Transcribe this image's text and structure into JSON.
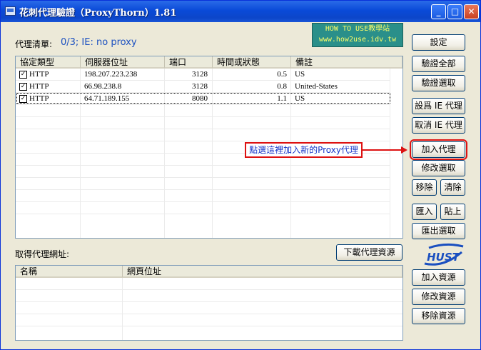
{
  "window": {
    "title": "花刺代理驗證（ProxyThorn）1.81"
  },
  "titlebar_buttons": {
    "minimize": "_",
    "maximize": "□",
    "close": "✕"
  },
  "proxy_list": {
    "label": "代理清單:",
    "status": "0/3;    IE: no proxy",
    "columns": [
      "協定類型",
      "伺服器位址",
      "端口",
      "時間或狀態",
      "備註"
    ],
    "rows": [
      {
        "type": "HTTP",
        "server": "198.207.223.238",
        "port": "3128",
        "status": "0.5",
        "note": "US",
        "checked": true
      },
      {
        "type": "HTTP",
        "server": "66.98.238.8",
        "port": "3128",
        "status": "0.8",
        "note": "United-States",
        "checked": true
      },
      {
        "type": "HTTP",
        "server": "64.71.189.155",
        "port": "8080",
        "status": "1.1",
        "note": "US",
        "checked": true
      }
    ]
  },
  "source": {
    "label": "取得代理網址:",
    "download_button": "下載代理資源",
    "columns": [
      "名稱",
      "網頁位址"
    ]
  },
  "buttons": {
    "settings": "設定",
    "verify_all": "驗證全部",
    "verify_selected": "驗證選取",
    "set_ie_proxy": "設爲 IE 代理",
    "cancel_ie_proxy": "取消 IE 代理",
    "add_proxy": "加入代理",
    "edit_selected": "修改選取",
    "remove": "移除",
    "clear": "清除",
    "import": "匯入",
    "paste": "貼上",
    "export_selected": "匯出選取",
    "add_resource": "加入資源",
    "edit_resource": "修改資源",
    "remove_resource": "移除資源"
  },
  "annotation": {
    "text": "點選這裡加入新的Proxy代理",
    "color": "#dd1111"
  },
  "watermark": {
    "line1": "HOW TO USE教學站",
    "line2": "www.how2use.idv.tw"
  },
  "logo": {
    "text": "HUST"
  },
  "colors": {
    "titlebar": "#0a4ad8",
    "status_text": "#1a4fc0",
    "annotation": "#dd1111"
  }
}
